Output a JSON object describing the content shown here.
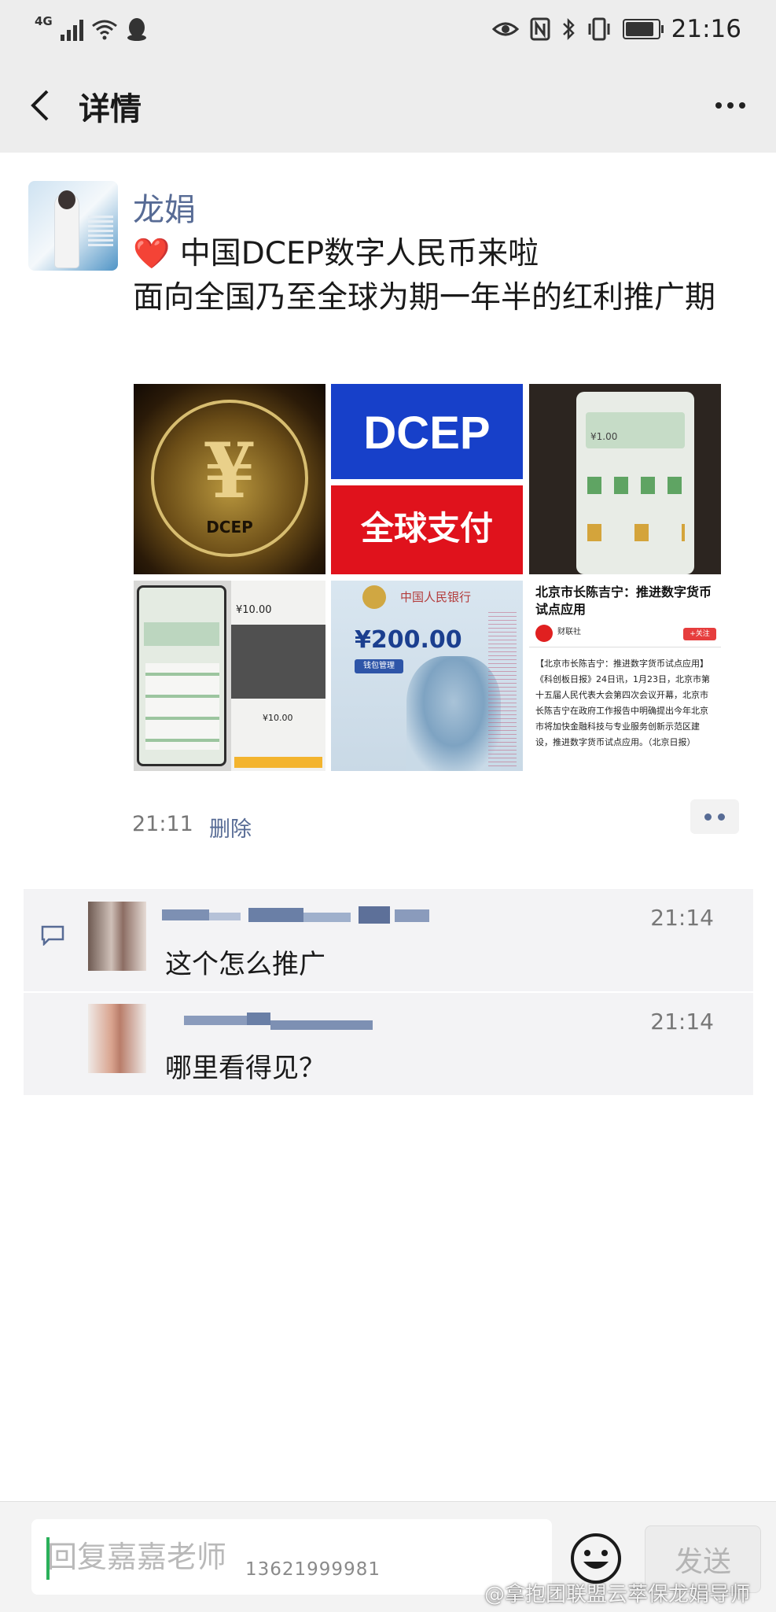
{
  "status_bar": {
    "network": "4G",
    "time": "21:16",
    "battery_level": 0.9
  },
  "header": {
    "title": "详情"
  },
  "post": {
    "author": "龙娟",
    "heart": "❤️",
    "line1": "中国DCEP数字人民币来啦",
    "line2": "面向全国乃至全球为期一年半的红利推广期",
    "time": "21:11",
    "delete_label": "删除",
    "images": {
      "coin_symbol": "¥",
      "coin_text": "DCEP",
      "dcep_top": "DCEP",
      "dcep_bottom": "全球支付",
      "phone_amount": "¥1.00",
      "screen_amount": "¥10.00",
      "screen_amount2": "¥10.00",
      "bank_name": "中国人民银行",
      "note_amount": "¥200.00",
      "wallet_label": "钱包管理",
      "news_headline": "北京市长陈吉宁：推进数字货币试点应用",
      "news_source": "财联社",
      "news_follow": "+关注",
      "news_body": "【北京市长陈吉宁：推进数字货币试点应用】《科创板日报》24日讯，1月23日，北京市第十五届人民代表大会第四次会议开幕，北京市长陈吉宁在政府工作报告中明确提出今年北京市将加快金融科技与专业服务创新示范区建设，推进数字货币试点应用。（北京日报）"
    }
  },
  "comments": [
    {
      "time": "21:14",
      "text": "这个怎么推广"
    },
    {
      "time": "21:14",
      "text": "哪里看得见？"
    }
  ],
  "reply": {
    "placeholder": "回复嘉嘉老师",
    "phone_overlay": "13621999981",
    "send_label": "发送"
  },
  "watermark": "@拿抱团联盟云萃保龙娟导师",
  "colors": {
    "link_blue": "#576b95",
    "caret_green": "#2ab05a",
    "header_bg": "#ededed"
  }
}
